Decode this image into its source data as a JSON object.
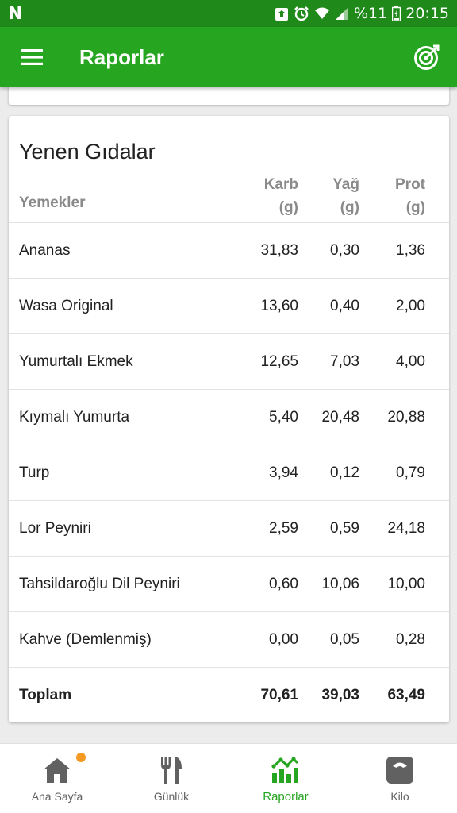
{
  "status_bar": {
    "left_glyph": "N",
    "battery_text": "%11",
    "time": "20:15",
    "icons": [
      "recycle-icon",
      "alarm-icon",
      "wifi-icon",
      "signal-icon",
      "battery-icon"
    ]
  },
  "app_bar": {
    "title": "Raporlar",
    "menu_icon": "hamburger-menu-icon",
    "action_icon": "target-icon"
  },
  "card": {
    "title": "Yenen Gıdalar",
    "columns": {
      "name": "Yemekler",
      "carb_line1": "Karb",
      "carb_line2": "(g)",
      "fat_line1": "Yağ",
      "fat_line2": "(g)",
      "prot_line1": "Prot",
      "prot_line2": "(g)"
    },
    "rows": [
      {
        "name": "Ananas",
        "carb": "31,83",
        "fat": "0,30",
        "prot": "1,36"
      },
      {
        "name": "Wasa Original",
        "carb": "13,60",
        "fat": "0,40",
        "prot": "2,00"
      },
      {
        "name": "Yumurtalı Ekmek",
        "carb": "12,65",
        "fat": "7,03",
        "prot": "4,00"
      },
      {
        "name": "Kıymalı Yumurta",
        "carb": "5,40",
        "fat": "20,48",
        "prot": "20,88"
      },
      {
        "name": "Turp",
        "carb": "3,94",
        "fat": "0,12",
        "prot": "0,79"
      },
      {
        "name": "Lor Peyniri",
        "carb": "2,59",
        "fat": "0,59",
        "prot": "24,18"
      },
      {
        "name": "Tahsildaroğlu Dil Peyniri",
        "carb": "0,60",
        "fat": "10,06",
        "prot": "10,00"
      },
      {
        "name": "Kahve (Demlenmiş)",
        "carb": "0,00",
        "fat": "0,05",
        "prot": "0,28"
      }
    ],
    "total": {
      "name": "Toplam",
      "carb": "70,61",
      "fat": "39,03",
      "prot": "63,49"
    }
  },
  "bottom_nav": {
    "items": [
      {
        "label": "Ana Sayfa",
        "icon": "home-icon",
        "active": false,
        "badge": true
      },
      {
        "label": "Günlük",
        "icon": "fork-knife-icon",
        "active": false,
        "badge": false
      },
      {
        "label": "Raporlar",
        "icon": "chart-icon",
        "active": true,
        "badge": false
      },
      {
        "label": "Kilo",
        "icon": "scale-icon",
        "active": false,
        "badge": false
      }
    ]
  },
  "colors": {
    "status_bar": "#1f8a1a",
    "app_bar": "#26a520",
    "accent": "#26a520",
    "badge": "#f59a23"
  }
}
